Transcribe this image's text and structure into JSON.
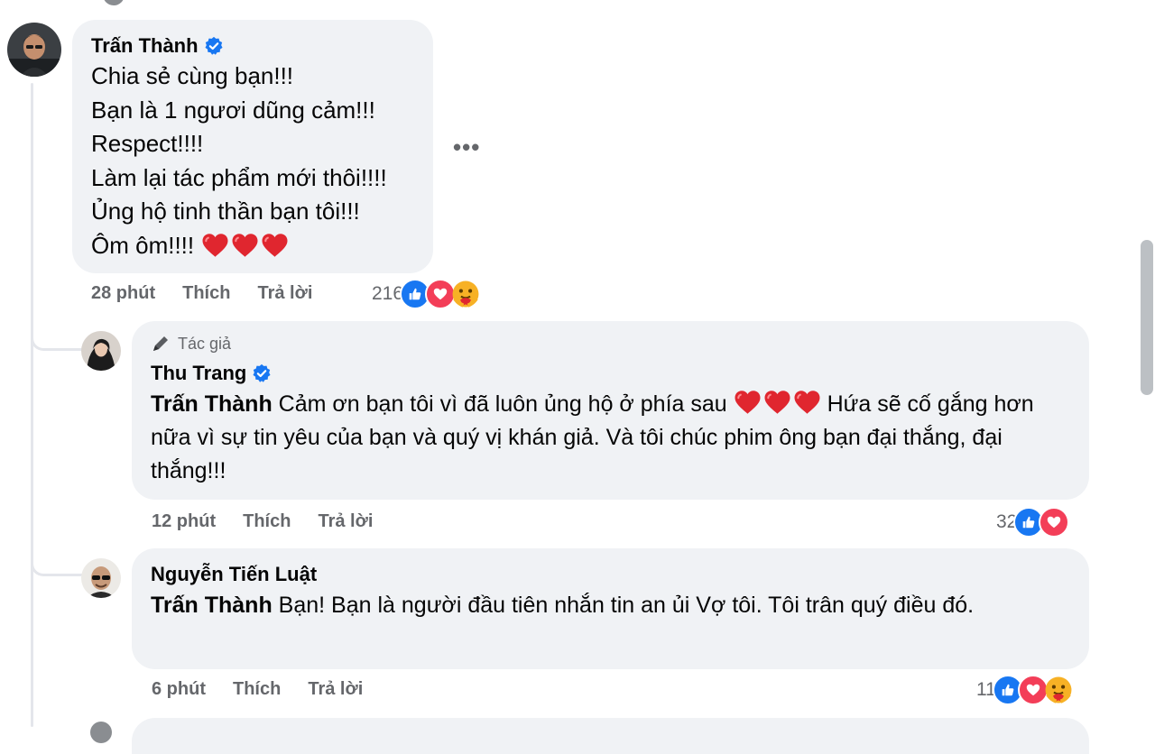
{
  "comments": [
    {
      "author": "Trấn Thành",
      "verified": true,
      "lines": [
        "Chia sẻ cùng bạn!!!",
        "Bạn là 1 ngươi dũng cảm!!!",
        "Respect!!!!",
        "Làm lại tác phẩm mới thôi!!!!",
        "Ủng hộ tinh thần bạn tôi!!!",
        "Ôm ôm!!!!"
      ],
      "time": "28 phút",
      "like_label": "Thích",
      "reply_label": "Trả lời",
      "reaction_count": "216",
      "reactions": [
        "like-icon",
        "love-icon",
        "care-icon"
      ]
    }
  ],
  "replies": [
    {
      "author_tag": "Tác giả",
      "author": "Thu Trang",
      "verified": true,
      "mention": "Trấn Thành",
      "text_part1": " Cảm ơn bạn tôi vì đã luôn ủng hộ ở phía sau ",
      "text_part2": " Hứa sẽ cố gắng hơn nữa vì sự tin yêu của bạn và quý vị khán giả. Và tôi chúc phim ông bạn đại thắng, đại thắng!!!",
      "time": "12 phút",
      "like_label": "Thích",
      "reply_label": "Trả lời",
      "reaction_count": "32",
      "reactions": [
        "like-icon",
        "love-icon"
      ]
    },
    {
      "author": "Nguyễn Tiến Luật",
      "verified": false,
      "mention": "Trấn Thành",
      "text": " Bạn! Bạn là người đầu tiên nhắn tin an ủi Vợ tôi. Tôi trân quý điều đó.",
      "time": "6 phút",
      "like_label": "Thích",
      "reply_label": "Trả lời",
      "reaction_count": "11",
      "reactions": [
        "like-icon",
        "love-icon",
        "care-icon"
      ]
    }
  ],
  "colors": {
    "bubble": "#f0f2f5",
    "meta_text": "#65676b",
    "like": "#1877f2",
    "love": "#f33e58",
    "care": "#f7b125",
    "thread_line": "#e4e6eb"
  }
}
